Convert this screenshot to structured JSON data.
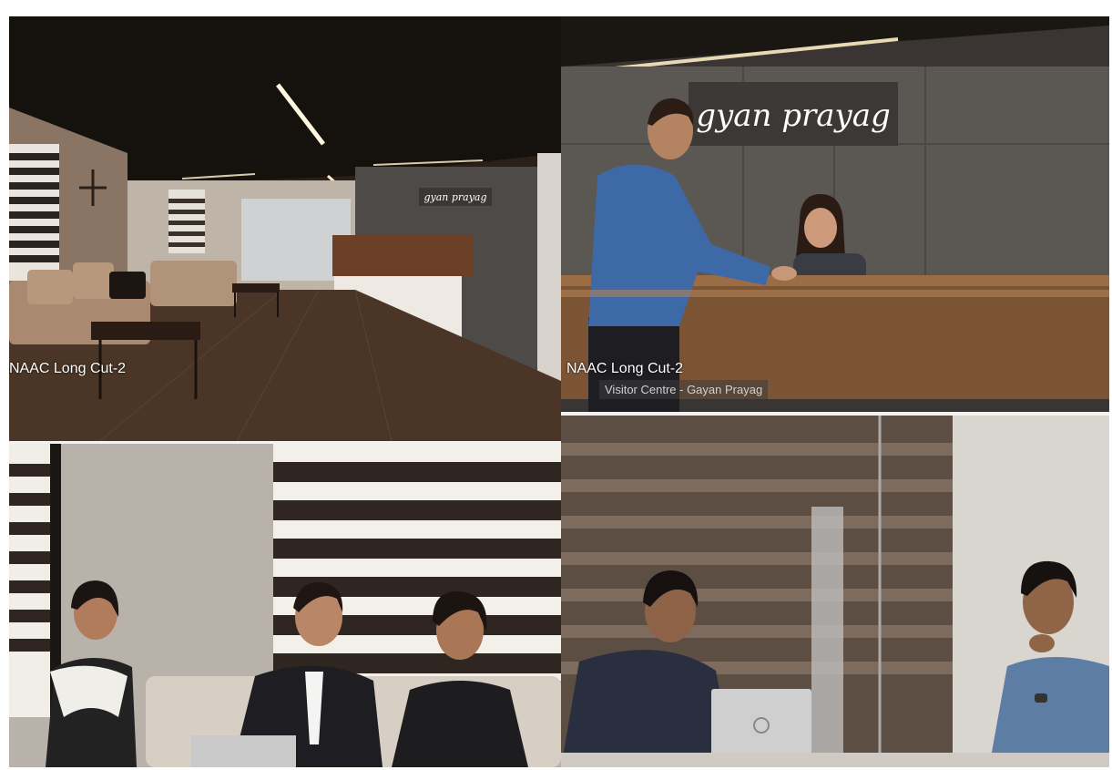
{
  "panels": {
    "top_left": {
      "caption": "NAAC Long Cut-2",
      "sign_text": "gyan prayag"
    },
    "top_right": {
      "caption": "NAAC Long Cut-2",
      "subcaption": "Visitor Centre - Gayan Prayag",
      "sign_text": "gyan prayag"
    },
    "bottom_left": {},
    "bottom_right": {}
  },
  "colors": {
    "ceiling": "#17130f",
    "wood": "#6b4027",
    "stone": "#4a4744",
    "white_glow": "#ffffff"
  }
}
